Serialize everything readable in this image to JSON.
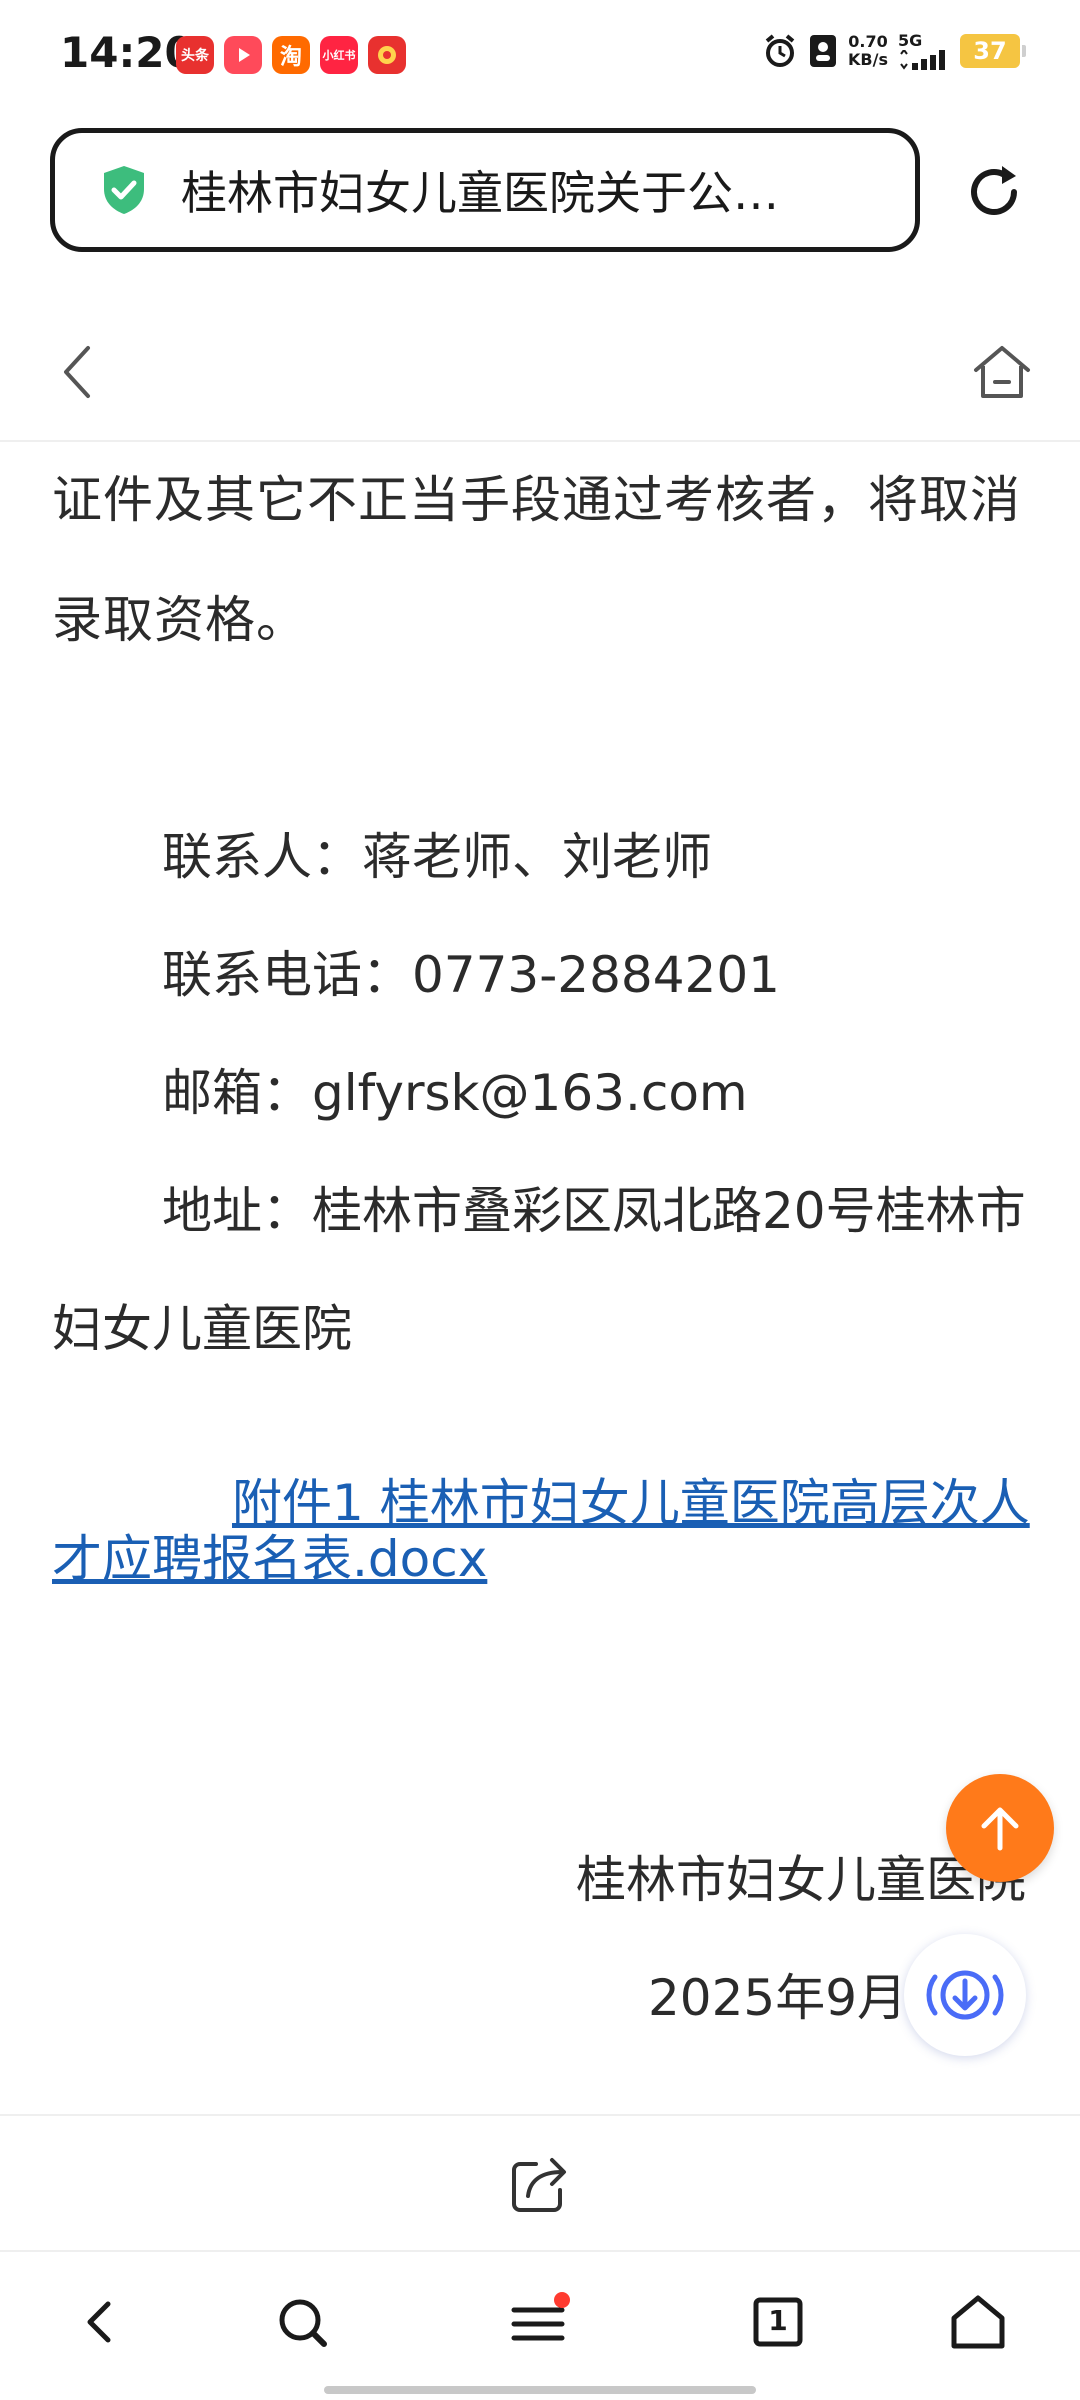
{
  "status_bar": {
    "time": "14:20",
    "apps": [
      {
        "name": "toutiao-app-icon",
        "label": "头条",
        "color": "#e8312f"
      },
      {
        "name": "video-app-icon",
        "label": "",
        "color": "#ff4a5a"
      },
      {
        "name": "taobao-app-icon",
        "label": "淘",
        "color": "#ff6a00"
      },
      {
        "name": "xiaohongshu-app-icon",
        "label": "小红书",
        "color": "#ff2442"
      },
      {
        "name": "red-envelope-app-icon",
        "label": "",
        "color": "#e8312f"
      }
    ],
    "net_speed_value": "0.70",
    "net_speed_unit": "KB/s",
    "net_type": "5G",
    "battery": "37"
  },
  "address_bar": {
    "title": "桂林市妇女儿童医院关于公…",
    "secure_color": "#3dbd7d"
  },
  "content": {
    "para1": "证件及其它不正当手段通过考核者，将取消录取资格。",
    "contact_person": "联系人：蒋老师、刘老师",
    "contact_phone": "联系电话：0773-2884201",
    "email": "邮箱：glfyrsk@163.com",
    "address": "地址：桂林市叠彩区凤北路20号桂林市妇女儿童医院",
    "attachment_link": "附件1 桂林市妇女儿童医院高层次人才应聘报名表.docx",
    "sign_org": "桂林市妇女儿童医院",
    "sign_date": "2025年9月"
  },
  "colors": {
    "link": "#1a5fb4",
    "to_top": "#ff7a1a",
    "audio_accent": "#4a6cf7",
    "menu_badge": "#ff3b30"
  },
  "bottom_nav": {
    "tab_count": "1"
  }
}
